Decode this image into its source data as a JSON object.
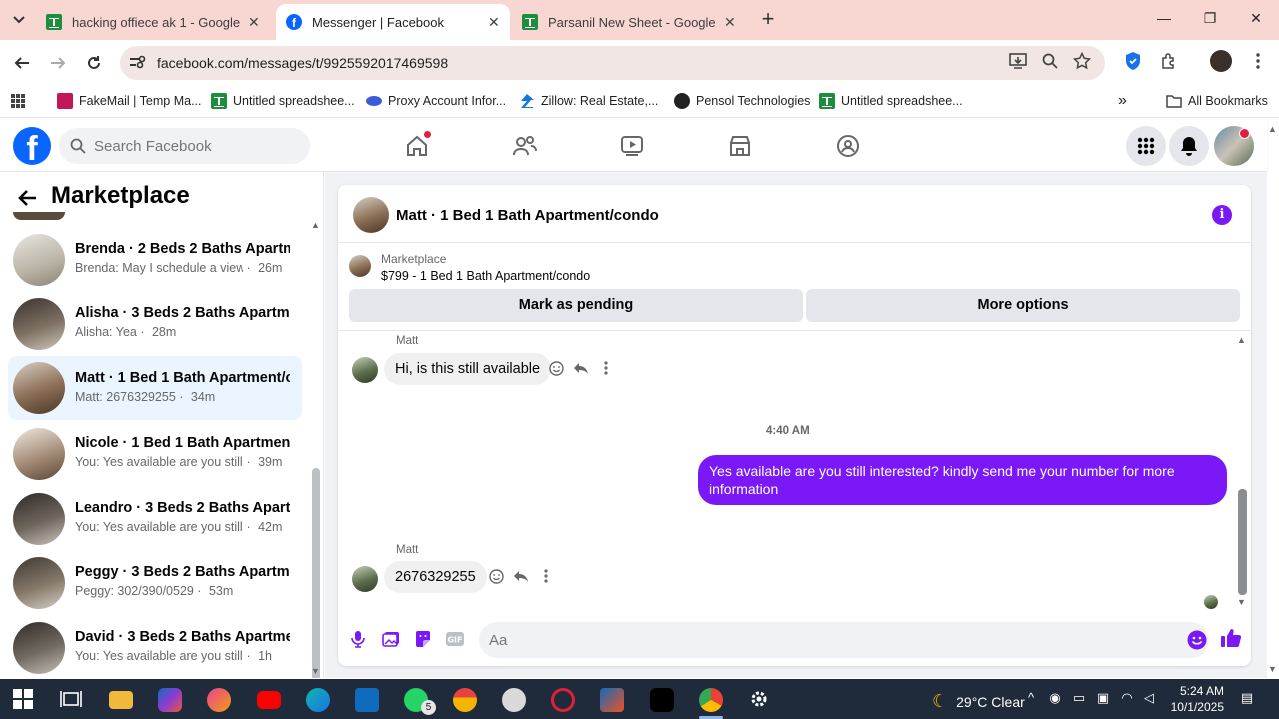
{
  "browser": {
    "tabs": [
      {
        "title": "hacking offiece ak 1 - Google S",
        "icon": "sheets-icon"
      },
      {
        "title": "Messenger | Facebook",
        "icon": "facebook-icon"
      },
      {
        "title": "Parsanil New Sheet - Google Sh",
        "icon": "sheets-icon"
      }
    ],
    "url": "facebook.com/messages/t/9925592017469598",
    "bookmarks": [
      {
        "label": "FakeMail | Temp Ma..."
      },
      {
        "label": "Untitled spreadshee..."
      },
      {
        "label": "Proxy Account Infor..."
      },
      {
        "label": "Zillow: Real Estate,..."
      },
      {
        "label": "Pensol Technologies"
      },
      {
        "label": "Untitled spreadshee..."
      }
    ],
    "all_bookmarks": "All Bookmarks"
  },
  "facebook": {
    "search_placeholder": "Search Facebook",
    "sidebar_title": "Marketplace",
    "conversations": [
      {
        "title": "Brenda · 2 Beds 2 Baths Apartm...",
        "preview": "Brenda: May I schedule a viewing...",
        "time": "26m",
        "active": false
      },
      {
        "title": "Alisha · 3 Beds 2 Baths Apartme...",
        "preview": "Alisha: Yea",
        "time": "28m",
        "active": false
      },
      {
        "title": "Matt · 1 Bed 1 Bath Apartment/c...",
        "preview": "Matt: 2676329255",
        "time": "34m",
        "active": true
      },
      {
        "title": "Nicole · 1 Bed 1 Bath Apartment...",
        "preview": "You: Yes available are you still int...",
        "time": "39m",
        "active": false
      },
      {
        "title": "Leandro · 3 Beds 2 Baths Apart...",
        "preview": "You: Yes available are you still int...",
        "time": "42m",
        "active": false
      },
      {
        "title": "Peggy · 3 Beds 2 Baths Apartme...",
        "preview": "Peggy: 302/390/0529",
        "time": "53m",
        "active": false
      },
      {
        "title": "David · 3 Beds 2 Baths Apartme...",
        "preview": "You: Yes available are you still inter...",
        "time": "1h",
        "active": false
      }
    ],
    "chat": {
      "title": "Matt · 1 Bed 1 Bath Apartment/condo",
      "marketplace_label": "Marketplace",
      "listing": "$799 - 1 Bed 1 Bath Apartment/condo",
      "mark_pending": "Mark as pending",
      "more_options": "More options",
      "messages": {
        "m1_sender": "Matt",
        "m1_text": "Hi, is this still available",
        "timestamp": "4:40 AM",
        "m2_text": "Yes available are you still interested? kindly send me your number for more information",
        "m3_sender": "Matt",
        "m3_text": "2676329255"
      },
      "composer_placeholder": "Aa",
      "accent": "#7b18f7"
    }
  },
  "taskbar": {
    "whatsapp_badge": "5",
    "weather": "29°C  Clear",
    "time": "5:24 AM",
    "date": "10/1/2025"
  }
}
